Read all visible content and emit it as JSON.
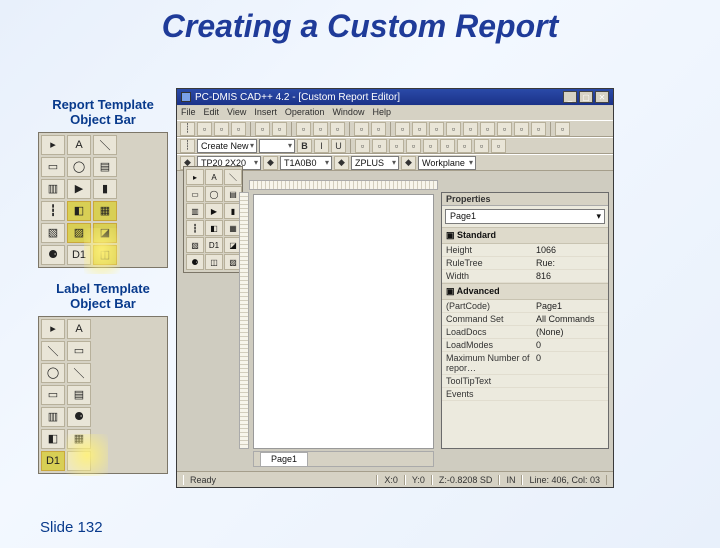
{
  "title": "Creating a Custom Report",
  "slide_number": "Slide 132",
  "left_palettes": {
    "report_title": "Report Template\nObject Bar",
    "label_title": "Label Template\nObject Bar",
    "report_cells": [
      "▸",
      "A",
      "＼",
      "▭",
      "◯",
      "▤",
      "▥",
      "▶",
      "▮",
      "┇",
      "◧",
      "▦",
      "▧",
      "▨",
      "◪",
      "⚈",
      "D1",
      "◫"
    ],
    "label_cells": [
      "▸",
      "A",
      "＼",
      "▭",
      "◯",
      "＼",
      "▭",
      "▤",
      "▥",
      "⚈",
      "◧",
      "▦",
      "D1",
      ""
    ]
  },
  "window": {
    "title": "PC-DMIS CAD++ 4.2 - [Custom Report Editor]",
    "menus": [
      "File",
      "Edit",
      "View",
      "Insert",
      "Operation",
      "Window",
      "Help"
    ],
    "toolbar_main": [
      "new",
      "open",
      "save",
      "|",
      "print",
      "preview",
      "|",
      "cut",
      "copy",
      "paste",
      "|",
      "undo",
      "redo",
      "|",
      "cfg1",
      "cfg2",
      "cfg3",
      "cfg4",
      "cfg5",
      "cfg6",
      "cfg7",
      "cfg8",
      "cfg9",
      "|",
      "help"
    ],
    "toolbar_fmt": {
      "edit_label": "Create New",
      "dd1": "",
      "bold": "B",
      "italic": "I",
      "under": "U",
      "align": [
        "left",
        "center",
        "right",
        "just"
      ],
      "extra": [
        "c1",
        "c2",
        "c3",
        "c4",
        "c5"
      ]
    },
    "toolbar_probe": {
      "dd_probe": "TP20 2X20",
      "dd_tip": "T1A0B0",
      "dd_align": "ZPLUS",
      "dd_wp": "Workplane"
    },
    "float_palette": [
      "▸",
      "A",
      "＼",
      "▭",
      "◯",
      "▤",
      "▥",
      "▶",
      "▮",
      "┇",
      "◧",
      "▦",
      "▧",
      "D1",
      "◪",
      "⚈",
      "◫",
      "▨"
    ],
    "properties": {
      "header": "Properties",
      "selection": "Page1",
      "sections": [
        {
          "name": "Standard",
          "rows": [
            {
              "n": "Height",
              "v": "1066"
            },
            {
              "n": "RuleTree",
              "v": "Rue:"
            },
            {
              "n": "Width",
              "v": "816"
            }
          ]
        },
        {
          "name": "Advanced",
          "rows": [
            {
              "n": "(PartCode)",
              "v": "Page1"
            },
            {
              "n": "Command Set",
              "v": "All Commands"
            },
            {
              "n": "LoadDocs",
              "v": "(None)"
            },
            {
              "n": "LoadModes",
              "v": "0"
            },
            {
              "n": "Maximum Number of repor…",
              "v": "0"
            },
            {
              "n": "ToolTipText",
              "v": ""
            },
            {
              "n": "Events",
              "v": ""
            }
          ]
        }
      ]
    },
    "page_tab": "Page1",
    "page_tab_buttons": [
      "b1",
      "b2",
      "b3",
      "b4",
      "b5",
      "b6",
      "b7",
      "b8",
      "b9",
      "b10",
      "b11",
      "b12"
    ],
    "status": {
      "ready": "Ready",
      "x": "X:0",
      "y": "Y:0",
      "z": "Z:-0.8208 SD",
      "mode": "IN",
      "loc": "Line: 406, Col: 03"
    }
  }
}
